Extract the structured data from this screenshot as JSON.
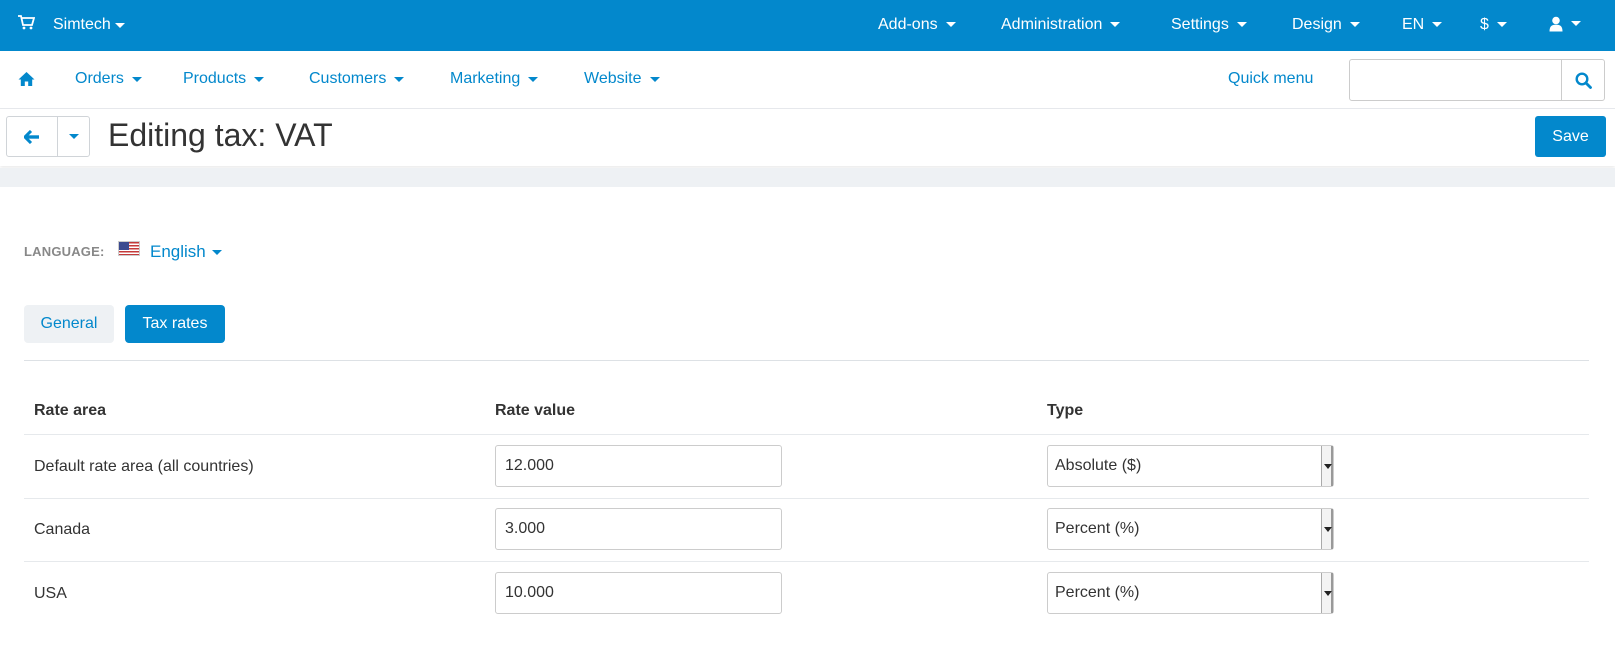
{
  "topbar": {
    "brand": "Simtech",
    "menus": [
      "Add-ons",
      "Administration",
      "Settings",
      "Design",
      "EN",
      "$"
    ],
    "icons": [
      "cart-icon",
      "user-icon"
    ]
  },
  "subnav": {
    "items": [
      "Orders",
      "Products",
      "Customers",
      "Marketing",
      "Website"
    ],
    "quick_menu": "Quick menu",
    "search_placeholder": ""
  },
  "titlebar": {
    "title": "Editing tax: VAT",
    "save_label": "Save"
  },
  "language": {
    "label": "LANGUAGE:",
    "value": "English"
  },
  "tabs": [
    {
      "label": "General",
      "active": false
    },
    {
      "label": "Tax rates",
      "active": true
    }
  ],
  "table": {
    "headers": [
      "Rate area",
      "Rate value",
      "Type"
    ],
    "rows": [
      {
        "area": "Default rate area (all countries)",
        "value": "12.000",
        "type": "Absolute ($)"
      },
      {
        "area": "Canada",
        "value": "3.000",
        "type": "Percent (%)"
      },
      {
        "area": "USA",
        "value": "10.000",
        "type": "Percent (%)"
      }
    ]
  },
  "colors": {
    "primary": "#0388cc",
    "strip": "#eef1f4"
  }
}
